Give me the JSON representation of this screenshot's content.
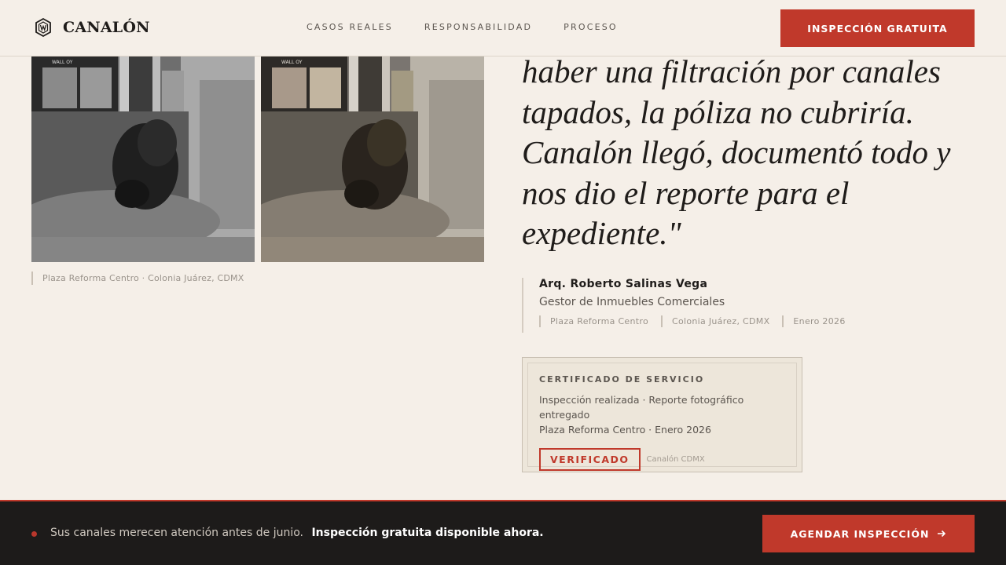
{
  "header": {
    "logo_text": "CANALÓN",
    "nav": [
      "CASOS REALES",
      "RESPONSABILIDAD",
      "PROCESO"
    ],
    "cta": "INSPECCIÓN GRATUITA"
  },
  "photos": {
    "storefront_sign": "WALL OY",
    "caption": "Plaza Reforma Centro · Colonia Juárez, CDMX"
  },
  "testimonial": {
    "quote": "haber una filtración por canales tapados, la póliza no cubriría. Canalón llegó, documentó todo y nos dio el reporte para el expediente.\"",
    "name": "Arq. Roberto Salinas Vega",
    "role": "Gestor de Inmuebles Comerciales",
    "meta": [
      "Plaza Reforma Centro",
      "Colonia Juárez, CDMX",
      "Enero 2026"
    ]
  },
  "certificate": {
    "title": "CERTIFICADO DE SERVICIO",
    "line1": "Inspección realizada · Reporte fotográfico entregado",
    "line2": "Plaza Reforma Centro · Enero 2026",
    "badge": "VERIFICADO",
    "brand": "Canalón CDMX"
  },
  "bottom_bar": {
    "text": "Sus canales merecen atención antes de junio.",
    "emphasis": "Inspección gratuita disponible ahora.",
    "cta": "AGENDAR INSPECCIÓN",
    "cta_icon": "arrow-right-icon"
  },
  "colors": {
    "accent": "#c0392b",
    "background": "#f5efe8",
    "dark": "#1d1b1a"
  }
}
